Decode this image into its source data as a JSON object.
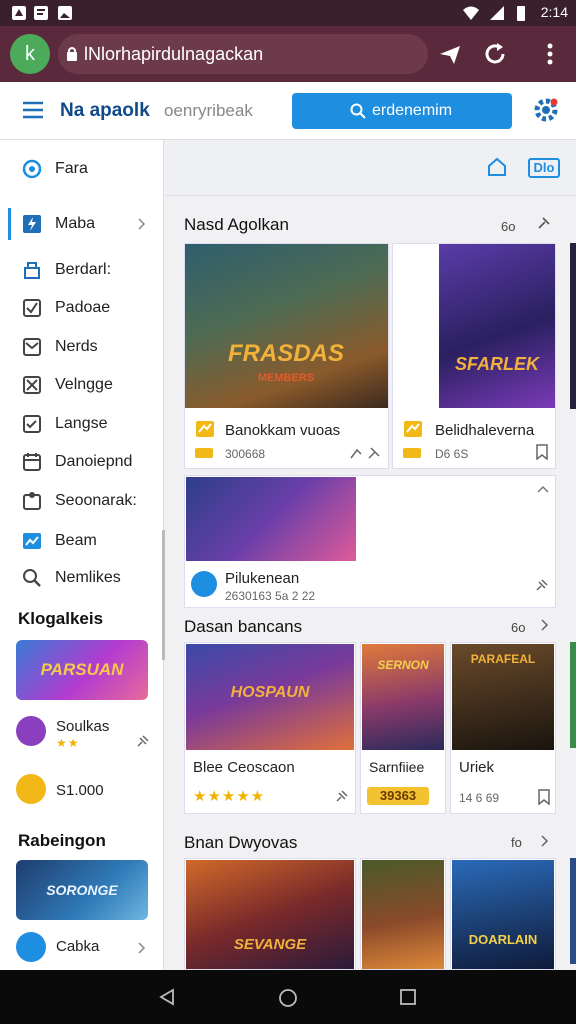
{
  "status_bar": {
    "time": "2:14"
  },
  "browser": {
    "url": "lNlorhapirdulnagackan",
    "site_icon_text": "k"
  },
  "header": {
    "title": "Na apaolk",
    "subtitle": "oenryribeak",
    "search_label": "erdenemim"
  },
  "toolbar": {
    "label": "Dlo"
  },
  "sidebar": {
    "items": [
      {
        "label": "Fara",
        "icon": "target-icon"
      },
      {
        "label": "Maba",
        "icon": "flash-icon"
      },
      {
        "label": "Berdarl:",
        "icon": "shop-icon"
      },
      {
        "label": "Padoae",
        "icon": "check-box-icon"
      },
      {
        "label": "Nerds",
        "icon": "envelope-icon"
      },
      {
        "label": "Velngge",
        "icon": "checked-box-icon"
      },
      {
        "label": "Langse",
        "icon": "inbox-icon"
      },
      {
        "label": "Danoiepnd",
        "icon": "calendar-icon"
      },
      {
        "label": "Seoonarak:",
        "icon": "badge-icon"
      },
      {
        "label": "Beam",
        "icon": "chart-icon"
      },
      {
        "label": "Nemlikes",
        "icon": "search-icon"
      }
    ],
    "section1": "Klogalkeis",
    "banner1_text": "PARSUAN",
    "app1": {
      "name": "Soulkas",
      "rating": "★★"
    },
    "app2": {
      "name": "S1.000"
    },
    "section2": "Rabeingon",
    "banner2_text": "SORONGE",
    "app3": {
      "name": "Cabka",
      "rating": "★★"
    }
  },
  "sections": [
    {
      "title": "Nasd Agolkan",
      "count": "6o"
    },
    {
      "title": "Dasan bancans",
      "count": "6o"
    },
    {
      "title": "Bnan Dwyovas",
      "count": "fo"
    }
  ],
  "featured": [
    {
      "art_text": "FRASDAS",
      "art_sub": "MEMBERS",
      "name": "Banokkam vuoas",
      "meta": "300668"
    },
    {
      "art_text": "SFARLEK",
      "name": "Belidhaleverna",
      "meta": "D6 6S"
    }
  ],
  "wide_card": {
    "name": "Pilukenean",
    "meta": "2630163 5a 2 22"
  },
  "row2": [
    {
      "art_text": "HOSPAUN",
      "name": "Blee Ceoscaon",
      "rating": "★★★★★"
    },
    {
      "art_text": "SERNON",
      "name": "Sarnfiiee",
      "meta": "39363"
    },
    {
      "art_text": "PARAFEAL",
      "name": "Uriek",
      "meta": "14 6 69"
    }
  ],
  "row3": [
    {
      "art_text": "SEVANGE"
    },
    {
      "art_text": ""
    },
    {
      "art_text": "DOARLAIN"
    }
  ],
  "colors": {
    "accent": "#1e8ee0",
    "browser": "#5a2a3c",
    "status": "#3a1f2c",
    "star": "#f0b400"
  }
}
